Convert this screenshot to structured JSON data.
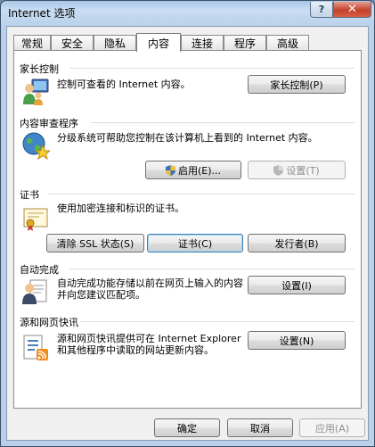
{
  "window": {
    "title": "Internet 选项",
    "help_glyph": "?",
    "close_glyph": "✕"
  },
  "tabs": [
    {
      "label": "常规"
    },
    {
      "label": "安全"
    },
    {
      "label": "隐私"
    },
    {
      "label": "内容"
    },
    {
      "label": "连接"
    },
    {
      "label": "程序"
    },
    {
      "label": "高级"
    }
  ],
  "active_tab": "内容",
  "parental": {
    "heading": "家长控制",
    "description": "控制可查看的 Internet 内容。",
    "button": "家长控制(P)"
  },
  "content_advisor": {
    "heading": "内容审查程序",
    "description": "分级系统可帮助您控制在该计算机上看到的 Internet 内容。",
    "enable_button": "启用(E)...",
    "settings_button": "设置(T)"
  },
  "certificates": {
    "heading": "证书",
    "description": "使用加密连接和标识的证书。",
    "clear_ssl_button": "清除 SSL 状态(S)",
    "certificates_button": "证书(C)",
    "publishers_button": "发行者(B)"
  },
  "autocomplete": {
    "heading": "自动完成",
    "description": "自动完成功能存储以前在网页上输入的内容并向您建议匹配项。",
    "button": "设置(I)"
  },
  "feeds": {
    "heading": "源和网页快讯",
    "description": "源和网页快讯提供可在 Internet Explorer 和其他程序中读取的网站更新内容。",
    "button": "设置(N)"
  },
  "footer": {
    "ok": "确定",
    "cancel": "取消",
    "apply": "应用(A)"
  },
  "colors": {
    "accent": "#3c7fb1",
    "close": "#c4422c",
    "section_line": "#d5dfe5"
  }
}
